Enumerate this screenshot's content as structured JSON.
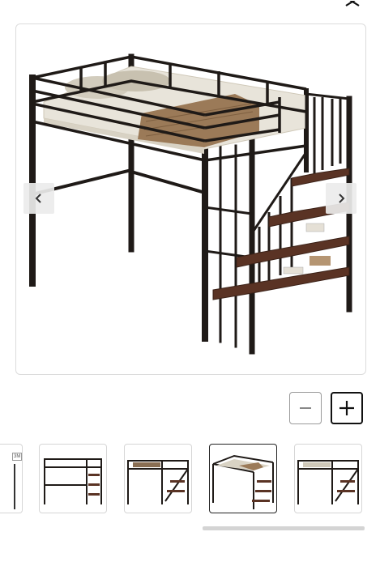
{
  "header": {
    "close_icon": "close-icon"
  },
  "main_image": {
    "image_icon": "metal-loft-bed-with-stairs-image",
    "prev_icon": "chevron-left-icon",
    "next_icon": "chevron-right-icon"
  },
  "zoom": {
    "out_icon": "minus-icon",
    "in_icon": "plus-icon"
  },
  "thumbnails": {
    "partial_label": "3M",
    "selected_index": 3,
    "count_visible": 5
  },
  "colors": {
    "frame": "#1f1a17",
    "wood": "#5a3324",
    "mattress": "#e8e4da",
    "border": "#dcdcdc"
  }
}
